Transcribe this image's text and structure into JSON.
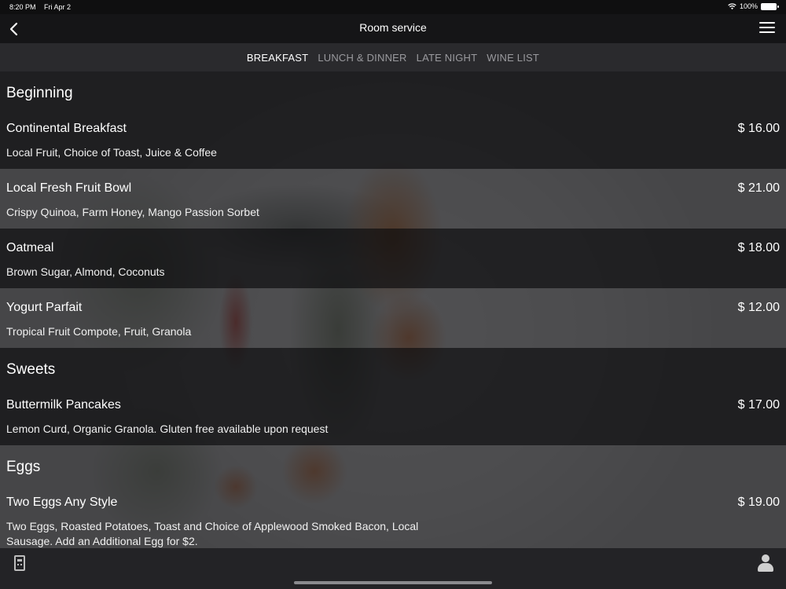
{
  "status_bar": {
    "time": "8:20 PM",
    "date": "Fri Apr 2",
    "battery": "100%"
  },
  "nav": {
    "title": "Room service",
    "back_icon": "chevron-left-icon",
    "menu_icon": "hamburger-menu-icon"
  },
  "tabs": [
    {
      "label": "BREAKFAST",
      "active": true
    },
    {
      "label": "LUNCH & DINNER",
      "active": false
    },
    {
      "label": "LATE NIGHT",
      "active": false
    },
    {
      "label": "WINE LIST",
      "active": false
    }
  ],
  "sections": [
    {
      "title": "Beginning",
      "items": [
        {
          "name": "Continental Breakfast",
          "price": "$ 16.00",
          "desc": "Local Fruit, Choice of Toast, Juice & Coffee"
        },
        {
          "name": "Local Fresh Fruit Bowl",
          "price": "$ 21.00",
          "desc": "Crispy Quinoa, Farm Honey, Mango Passion Sorbet"
        },
        {
          "name": "Oatmeal",
          "price": "$ 18.00",
          "desc": "Brown Sugar, Almond, Coconuts"
        },
        {
          "name": "Yogurt Parfait",
          "price": "$ 12.00",
          "desc": "Tropical Fruit Compote, Fruit, Granola"
        }
      ]
    },
    {
      "title": "Sweets",
      "items": [
        {
          "name": "Buttermilk Pancakes",
          "price": "$ 17.00",
          "desc": "Lemon Curd, Organic Granola. Gluten free available upon request"
        }
      ]
    },
    {
      "title": "Eggs",
      "items": [
        {
          "name": "Two Eggs Any Style",
          "price": "$ 19.00",
          "desc": "Two Eggs, Roasted Potatoes, Toast and Choice of Applewood Smoked Bacon, Local Sausage. Add an Additional Egg for $2."
        }
      ]
    }
  ],
  "toolbar": {
    "left_icon": "remote-control-icon",
    "right_icon": "user-profile-icon"
  }
}
